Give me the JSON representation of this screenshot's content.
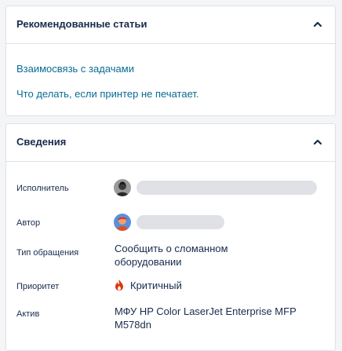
{
  "recommended": {
    "title": "Рекомендованные статьи",
    "articles": [
      "Взаимосвязь с задачами",
      "Что делать, если принтер не печатает."
    ]
  },
  "details": {
    "title": "Сведения",
    "assignee_label": "Исполнитель",
    "author_label": "Автор",
    "request_type_label": "Тип обращения",
    "request_type_value_line1": "Сообщить о сломанном",
    "request_type_value_line2": "оборудовании",
    "priority_label": "Приоритет",
    "priority_value": "Критичный",
    "asset_label": "Актив",
    "asset_value_line1": "МФУ HP Color LaserJet Enterprise MFP",
    "asset_value_line2": "M578dn"
  },
  "icons": {
    "collapse": "chevron-up-icon",
    "priority": "flame-icon"
  },
  "colors": {
    "link": "#0a6b94",
    "priority_critical": "#de350b",
    "placeholder": "#dfe1e6"
  }
}
